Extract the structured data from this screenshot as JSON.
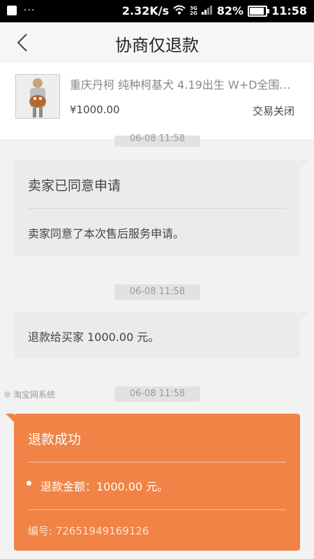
{
  "status_bar": {
    "speed": "2.32K/s",
    "network": "3G",
    "network2": "2G",
    "battery": "82%",
    "time": "11:58"
  },
  "header": {
    "title": "协商仅退款"
  },
  "product": {
    "title": "重庆丹柯 纯种柯基犬 4.19出生 W+D全围脖…",
    "price": "¥1000.00",
    "status": "交易关闭"
  },
  "messages": {
    "top_timestamp": "06-08 11:58",
    "agree": {
      "title": "卖家已同意申请",
      "text": "卖家同意了本次售后服务申请。"
    },
    "ts2": "06-08 11:58",
    "refund": {
      "text": "退款给买家 1000.00 元。"
    },
    "system_label": "淘宝网系统",
    "ts3": "06-08 11:58",
    "success": {
      "title": "退款成功",
      "amount": "退款金额：1000.00 元。",
      "id": "编号: 72651949169126"
    }
  },
  "colors": {
    "accent": "#f08345",
    "bubble": "#ebebeb"
  },
  "icons": {
    "back": "chevron-left-icon",
    "wifi": "wifi-icon",
    "signal": "signal-icon",
    "battery": "battery-icon"
  }
}
